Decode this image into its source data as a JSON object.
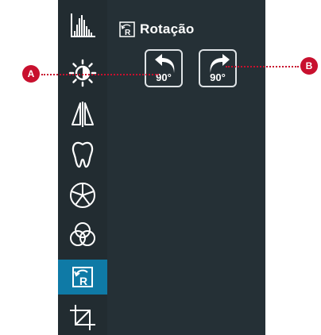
{
  "panel": {
    "title": "Rotação",
    "rotate_left_degrees": "90°",
    "rotate_right_degrees": "90°"
  },
  "callouts": {
    "a": "A",
    "b": "B"
  },
  "toolbar": {
    "active_tool": "rotation",
    "icons": [
      "histogram-icon",
      "brightness-icon",
      "mirror-icon",
      "tooth-icon",
      "aperture-icon",
      "color-channels-icon",
      "rotation-icon",
      "crop-icon"
    ]
  },
  "colors": {
    "panel_bg": "#253036",
    "toolbar_bg": "#222c31",
    "active_tool_bg": "#0f7aa6",
    "callout": "#c8102e"
  }
}
